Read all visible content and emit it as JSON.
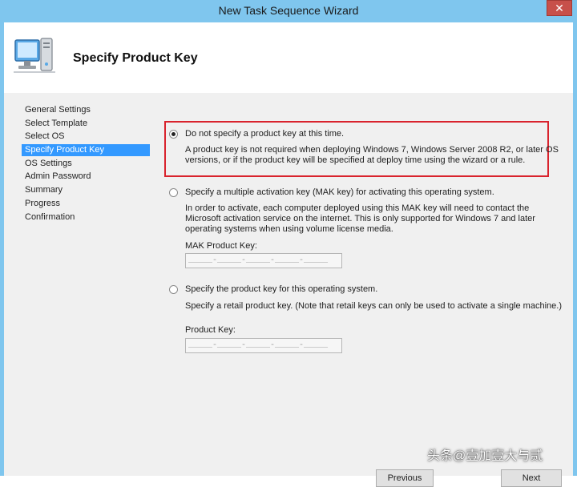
{
  "window": {
    "title": "New Task Sequence Wizard",
    "close_glyph": "✕"
  },
  "header": {
    "title": "Specify Product Key",
    "icon": "computer-wizard-icon"
  },
  "nav": {
    "items": [
      {
        "label": "General Settings",
        "active": false
      },
      {
        "label": "Select Template",
        "active": false
      },
      {
        "label": "Select OS",
        "active": false
      },
      {
        "label": "Specify Product Key",
        "active": true
      },
      {
        "label": "OS Settings",
        "active": false
      },
      {
        "label": "Admin Password",
        "active": false
      },
      {
        "label": "Summary",
        "active": false
      },
      {
        "label": "Progress",
        "active": false
      },
      {
        "label": "Confirmation",
        "active": false
      }
    ]
  },
  "options": {
    "none": {
      "label": "Do not specify a product key at this time.",
      "description": "A product key is not required when deploying Windows 7, Windows Server 2008 R2, or later OS versions, or if the product key will be specified at deploy time using the wizard or a rule.",
      "checked": true
    },
    "mak": {
      "label": "Specify a multiple activation key (MAK key) for activating this operating system.",
      "description": "In order to activate, each computer deployed using this MAK key will need to contact the Microsoft activation service on the internet.  This is only supported for Windows 7 and later operating systems when using volume license media.",
      "field_label": "MAK Product Key:",
      "mask": "_____-_____-_____-_____-_____",
      "checked": false
    },
    "retail": {
      "label": "Specify the product key for this operating system.",
      "description": "Specify a retail product key.  (Note that retail keys can only be used to activate a single machine.)",
      "field_label": "Product Key:",
      "mask": "_____-_____-_____-_____-_____",
      "checked": false
    }
  },
  "buttons": {
    "previous": "Previous",
    "next": "Next"
  },
  "watermark": "头条@壹加壹大与贰",
  "colors": {
    "title_bar": "#7fc6ee",
    "selection": "#3399ff",
    "highlight_border": "#d9232d"
  }
}
